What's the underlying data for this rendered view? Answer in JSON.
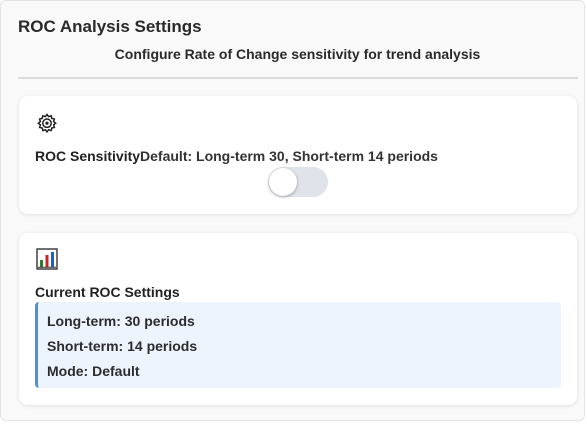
{
  "panel": {
    "title": "ROC Analysis Settings",
    "subtitle": "Configure Rate of Change sensitivity for trend analysis"
  },
  "sensitivity_card": {
    "icon": "gear-icon",
    "label": "ROC Sensitivity",
    "description": "Default: Long-term 30, Short-term 14 periods",
    "toggle_on": false
  },
  "current_card": {
    "icon": "bar-chart-icon",
    "heading": "Current ROC Settings",
    "accent_color": "#4a90e2",
    "lines": [
      "Long-term: 30 periods",
      "Short-term: 14 periods",
      "Mode: Default"
    ]
  }
}
